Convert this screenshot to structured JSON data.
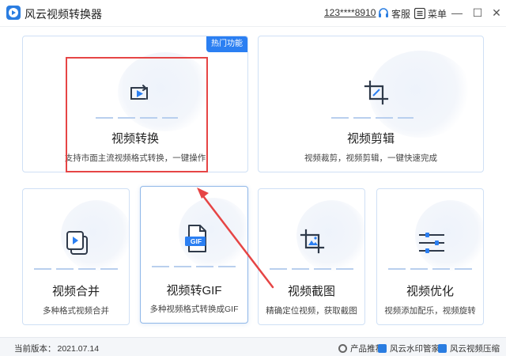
{
  "app": {
    "title": "风云视频转换器",
    "account": "123****8910",
    "service_label": "客服",
    "menu_label": "菜单",
    "minimize": "—",
    "maximize": "☐",
    "close": "✕"
  },
  "cards": {
    "convert": {
      "title": "视频转换",
      "desc": "支持市面主流视频格式转换，一键操作",
      "badge": "热门功能"
    },
    "edit": {
      "title": "视频剪辑",
      "desc": "视频裁剪，视频剪辑，一键快速完成"
    },
    "merge": {
      "title": "视频合并",
      "desc": "多种格式视频合并"
    },
    "to_gif": {
      "title": "视频转GIF",
      "desc": "多种视频格式转换成GIF",
      "icon_text": "GIF"
    },
    "screenshot": {
      "title": "视频截图",
      "desc": "精确定位视频，获取截图"
    },
    "optimize": {
      "title": "视频优化",
      "desc": "视频添加配乐，视频旋转"
    }
  },
  "status": {
    "version_label": "当前版本：",
    "version": "2021.07.14",
    "promo_label": "产品推荐:",
    "promo_a": "风云水印管家",
    "promo_b": "风云视频压缩"
  },
  "colors": {
    "accent": "#2b7ff2",
    "icon_dark": "#2f3a4a",
    "highlight": "#e64545"
  }
}
